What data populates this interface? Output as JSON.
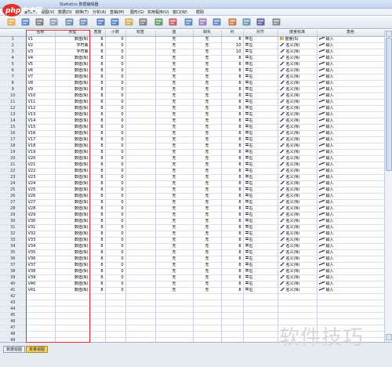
{
  "window": {
    "title": "Statistics 数据编辑器"
  },
  "logo": {
    "text": "php中文网"
  },
  "menu": [
    "编辑(E)",
    "视图(V)",
    "数据(D)",
    "转换(T)",
    "分析(A)",
    "直销(M)",
    "图形(G)",
    "实用程序(U)",
    "窗口(W)",
    "帮助"
  ],
  "toolbar": [
    "open-icon",
    "save-icon",
    "print-icon",
    "dialog-recall-icon",
    "undo-icon",
    "redo-icon",
    "goto-case-icon",
    "goto-variable-icon",
    "variables-icon",
    "find-icon",
    "insert-cases-icon",
    "insert-variable-icon",
    "split-file-icon",
    "weight-cases-icon",
    "select-cases-icon",
    "value-labels-icon",
    "use-sets-icon",
    "show-all-icon",
    "spell-icon"
  ],
  "grid": {
    "headers": [
      "",
      "名称",
      "类型",
      "宽度",
      "小数",
      "标签",
      "值",
      "缺失",
      "列",
      "对齐",
      "度量标准",
      "角色"
    ],
    "rows": [
      [
        "1",
        "V1",
        "数值(N)",
        "8",
        "0",
        "",
        "无",
        "无",
        "8",
        "右",
        "度量(S)",
        "输入"
      ],
      [
        "2",
        "V2",
        "字符串",
        "8",
        "0",
        "",
        "无",
        "无",
        "10",
        "左",
        "名义(N)",
        "输入"
      ],
      [
        "3",
        "V3",
        "字符串",
        "8",
        "0",
        "",
        "无",
        "无",
        "10",
        "左",
        "名义(N)",
        "输入"
      ],
      [
        "4",
        "V4",
        "数值(N)",
        "8",
        "0",
        "",
        "无",
        "无",
        "8",
        "右",
        "名义(N)",
        "输入"
      ],
      [
        "5",
        "V5",
        "数值(N)",
        "8",
        "0",
        "",
        "无",
        "无",
        "8",
        "右",
        "名义(N)",
        "输入"
      ],
      [
        "6",
        "V6",
        "数值(N)",
        "8",
        "0",
        "",
        "无",
        "无",
        "8",
        "右",
        "名义(N)",
        "输入"
      ],
      [
        "7",
        "V7",
        "数值(N)",
        "8",
        "0",
        "",
        "无",
        "无",
        "8",
        "右",
        "名义(N)",
        "输入"
      ],
      [
        "8",
        "V8",
        "数值(N)",
        "8",
        "0",
        "",
        "无",
        "无",
        "8",
        "右",
        "名义(N)",
        "输入"
      ],
      [
        "9",
        "V9",
        "数值(N)",
        "8",
        "0",
        "",
        "无",
        "无",
        "8",
        "右",
        "名义(N)",
        "输入"
      ],
      [
        "10",
        "V10",
        "数值(N)",
        "8",
        "0",
        "",
        "无",
        "无",
        "8",
        "右",
        "名义(N)",
        "输入"
      ],
      [
        "11",
        "V11",
        "数值(N)",
        "8",
        "0",
        "",
        "无",
        "无",
        "8",
        "右",
        "名义(N)",
        "输入"
      ],
      [
        "12",
        "V12",
        "数值(N)",
        "8",
        "0",
        "",
        "无",
        "无",
        "8",
        "右",
        "名义(N)",
        "输入"
      ],
      [
        "13",
        "V13",
        "数值(N)",
        "8",
        "0",
        "",
        "无",
        "无",
        "8",
        "右",
        "名义(N)",
        "输入"
      ],
      [
        "14",
        "V14",
        "数值(N)",
        "8",
        "0",
        "",
        "无",
        "无",
        "8",
        "右",
        "名义(N)",
        "输入"
      ],
      [
        "15",
        "V15",
        "数值(N)",
        "8",
        "0",
        "",
        "无",
        "无",
        "8",
        "右",
        "名义(N)",
        "输入"
      ],
      [
        "16",
        "V16",
        "数值(N)",
        "8",
        "0",
        "",
        "无",
        "无",
        "8",
        "右",
        "名义(N)",
        "输入"
      ],
      [
        "17",
        "V17",
        "数值(N)",
        "8",
        "0",
        "",
        "无",
        "无",
        "8",
        "右",
        "名义(N)",
        "输入"
      ],
      [
        "18",
        "V18",
        "数值(N)",
        "8",
        "0",
        "",
        "无",
        "无",
        "8",
        "右",
        "名义(N)",
        "输入"
      ],
      [
        "19",
        "V19",
        "数值(N)",
        "8",
        "0",
        "",
        "无",
        "无",
        "8",
        "右",
        "名义(N)",
        "输入"
      ],
      [
        "20",
        "V20",
        "数值(N)",
        "8",
        "0",
        "",
        "无",
        "无",
        "8",
        "右",
        "名义(N)",
        "输入"
      ],
      [
        "21",
        "V21",
        "数值(N)",
        "8",
        "0",
        "",
        "无",
        "无",
        "8",
        "右",
        "名义(N)",
        "输入"
      ],
      [
        "22",
        "V22",
        "数值(N)",
        "8",
        "0",
        "",
        "无",
        "无",
        "8",
        "右",
        "名义(N)",
        "输入"
      ],
      [
        "23",
        "V23",
        "数值(N)",
        "8",
        "0",
        "",
        "无",
        "无",
        "8",
        "右",
        "名义(N)",
        "输入"
      ],
      [
        "24",
        "V24",
        "数值(N)",
        "8",
        "0",
        "",
        "无",
        "无",
        "8",
        "右",
        "名义(N)",
        "输入"
      ],
      [
        "25",
        "V25",
        "数值(N)",
        "8",
        "0",
        "",
        "无",
        "无",
        "8",
        "右",
        "名义(N)",
        "输入"
      ],
      [
        "26",
        "V26",
        "数值(N)",
        "8",
        "0",
        "",
        "无",
        "无",
        "8",
        "右",
        "名义(N)",
        "输入"
      ],
      [
        "27",
        "V27",
        "数值(N)",
        "8",
        "0",
        "",
        "无",
        "无",
        "8",
        "右",
        "名义(N)",
        "输入"
      ],
      [
        "28",
        "V28",
        "数值(N)",
        "8",
        "0",
        "",
        "无",
        "无",
        "8",
        "右",
        "名义(N)",
        "输入"
      ],
      [
        "29",
        "V29",
        "数值(N)",
        "8",
        "0",
        "",
        "无",
        "无",
        "8",
        "右",
        "名义(N)",
        "输入"
      ],
      [
        "30",
        "V30",
        "数值(N)",
        "8",
        "0",
        "",
        "无",
        "无",
        "8",
        "右",
        "名义(N)",
        "输入"
      ],
      [
        "31",
        "V31",
        "数值(N)",
        "8",
        "0",
        "",
        "无",
        "无",
        "8",
        "右",
        "名义(N)",
        "输入"
      ],
      [
        "32",
        "V32",
        "数值(N)",
        "8",
        "0",
        "",
        "无",
        "无",
        "8",
        "右",
        "名义(N)",
        "输入"
      ],
      [
        "33",
        "V33",
        "数值(N)",
        "8",
        "0",
        "",
        "无",
        "无",
        "8",
        "右",
        "名义(N)",
        "输入"
      ],
      [
        "34",
        "V34",
        "数值(N)",
        "8",
        "0",
        "",
        "无",
        "无",
        "8",
        "右",
        "名义(N)",
        "输入"
      ],
      [
        "35",
        "V35",
        "数值(N)",
        "8",
        "0",
        "",
        "无",
        "无",
        "8",
        "右",
        "名义(N)",
        "输入"
      ],
      [
        "36",
        "V36",
        "数值(N)",
        "8",
        "0",
        "",
        "无",
        "无",
        "8",
        "右",
        "名义(N)",
        "输入"
      ],
      [
        "37",
        "V37",
        "数值(N)",
        "8",
        "0",
        "",
        "无",
        "无",
        "8",
        "右",
        "名义(N)",
        "输入"
      ],
      [
        "38",
        "V38",
        "数值(N)",
        "8",
        "0",
        "",
        "无",
        "无",
        "8",
        "右",
        "名义(N)",
        "输入"
      ],
      [
        "39",
        "V39",
        "数值(N)",
        "8",
        "0",
        "",
        "无",
        "无",
        "8",
        "右",
        "名义(N)",
        "输入"
      ],
      [
        "40",
        "V40",
        "数值(N)",
        "8",
        "0",
        "",
        "无",
        "无",
        "8",
        "右",
        "名义(N)",
        "输入"
      ],
      [
        "41",
        "V41",
        "数值(N)",
        "8",
        "0",
        "",
        "无",
        "无",
        "8",
        "右",
        "名义(N)",
        "输入"
      ],
      [
        "42",
        "",
        "",
        "",
        "",
        "",
        "",
        "",
        "",
        "",
        "",
        ""
      ],
      [
        "43",
        "",
        "",
        "",
        "",
        "",
        "",
        "",
        "",
        "",
        "",
        ""
      ],
      [
        "44",
        "",
        "",
        "",
        "",
        "",
        "",
        "",
        "",
        "",
        "",
        ""
      ],
      [
        "45",
        "",
        "",
        "",
        "",
        "",
        "",
        "",
        "",
        "",
        "",
        ""
      ],
      [
        "46",
        "",
        "",
        "",
        "",
        "",
        "",
        "",
        "",
        "",
        "",
        ""
      ],
      [
        "47",
        "",
        "",
        "",
        "",
        "",
        "",
        "",
        "",
        "",
        "",
        ""
      ],
      [
        "48",
        "",
        "",
        "",
        "",
        "",
        "",
        "",
        "",
        "",
        "",
        ""
      ],
      [
        "49",
        "",
        "",
        "",
        "",
        "",
        "",
        "",
        "",
        "",
        "",
        ""
      ],
      [
        "50",
        "",
        "",
        "",
        "",
        "",
        "",
        "",
        "",
        "",
        "",
        ""
      ]
    ]
  },
  "tabs": [
    {
      "label": "数据视图",
      "active": false
    },
    {
      "label": "变量视图",
      "active": true
    }
  ],
  "watermark": "软件技巧",
  "colors": {
    "highlight": "#e0303a",
    "active_tab": "#f6d46b",
    "row_header": "#e8edf4"
  }
}
